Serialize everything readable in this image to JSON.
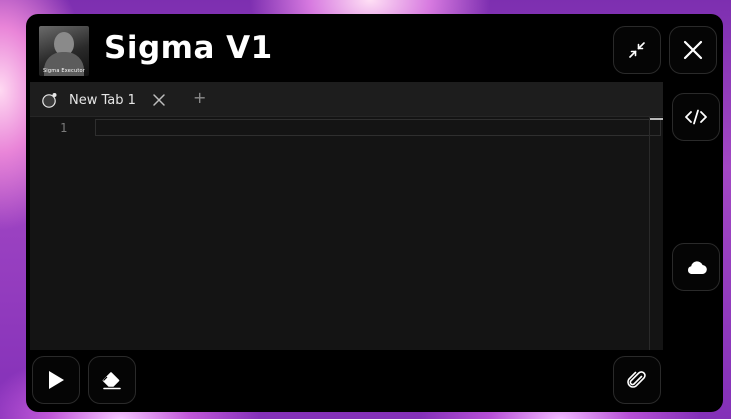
{
  "app": {
    "title": "Sigma V1",
    "logo_caption": "Sigma Executor"
  },
  "tabs": [
    {
      "label": "New Tab 1",
      "active": true
    }
  ],
  "editor": {
    "line_numbers": [
      "1"
    ],
    "content": ""
  },
  "icons": {
    "minimize": "minimize-icon",
    "close": "close-icon",
    "code": "code-icon",
    "cloud": "cloud-icon",
    "execute": "play-icon",
    "clear": "eraser-icon",
    "attach": "paperclip-icon",
    "tab": "script-tab-icon",
    "add_tab": "plus-icon"
  },
  "colors": {
    "window_bg": "#000000",
    "editor_bg": "#141414",
    "tabbar_bg": "#1d1d1d",
    "text": "#ffffff"
  }
}
